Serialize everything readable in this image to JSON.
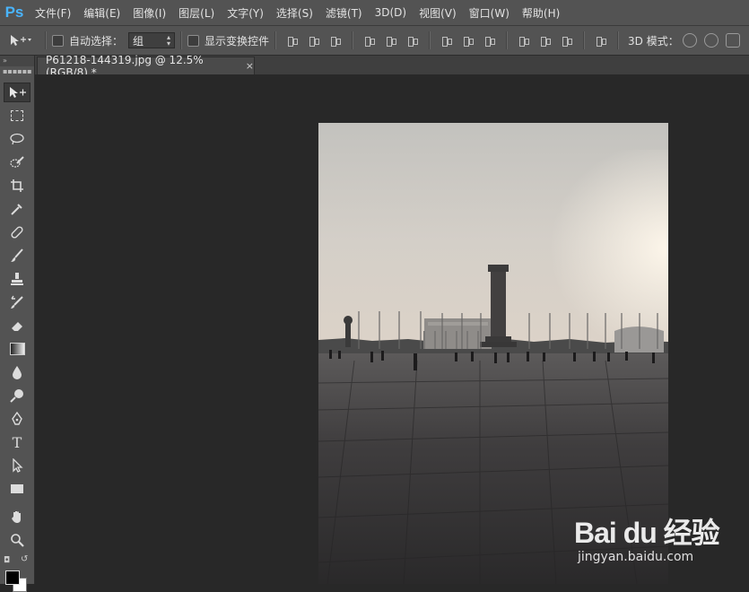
{
  "app": {
    "logo_text": "Ps",
    "accent_color": "#49b4ff"
  },
  "menu": [
    "文件(F)",
    "编辑(E)",
    "图像(I)",
    "图层(L)",
    "文字(Y)",
    "选择(S)",
    "滤镜(T)",
    "3D(D)",
    "视图(V)",
    "窗口(W)",
    "帮助(H)"
  ],
  "options": {
    "auto_select_label": "自动选择：",
    "auto_select_checked": false,
    "auto_select_value": "组",
    "show_transform_label": "显示变换控件",
    "show_transform_checked": false,
    "mode_3d_label": "3D 模式："
  },
  "toolbar": {
    "tools": [
      "move-tool",
      "marquee-tool",
      "lasso-tool",
      "quick-select-tool",
      "crop-tool",
      "eyedropper-tool",
      "healing-brush-tool",
      "brush-tool",
      "clone-stamp-tool",
      "history-brush-tool",
      "eraser-tool",
      "gradient-tool",
      "blur-tool",
      "dodge-tool",
      "pen-tool",
      "type-tool",
      "path-select-tool",
      "rectangle-tool",
      "hand-tool",
      "zoom-tool"
    ],
    "active_tool": "move-tool",
    "foreground_color": "#000000",
    "background_color": "#ffffff"
  },
  "document": {
    "tab_title": "P61218-144319.jpg @ 12.5%(RGB/8) *",
    "close_symbol": "×"
  },
  "watermark": {
    "brand": "Bai du 经验",
    "site": "jingyan.baidu.com"
  }
}
